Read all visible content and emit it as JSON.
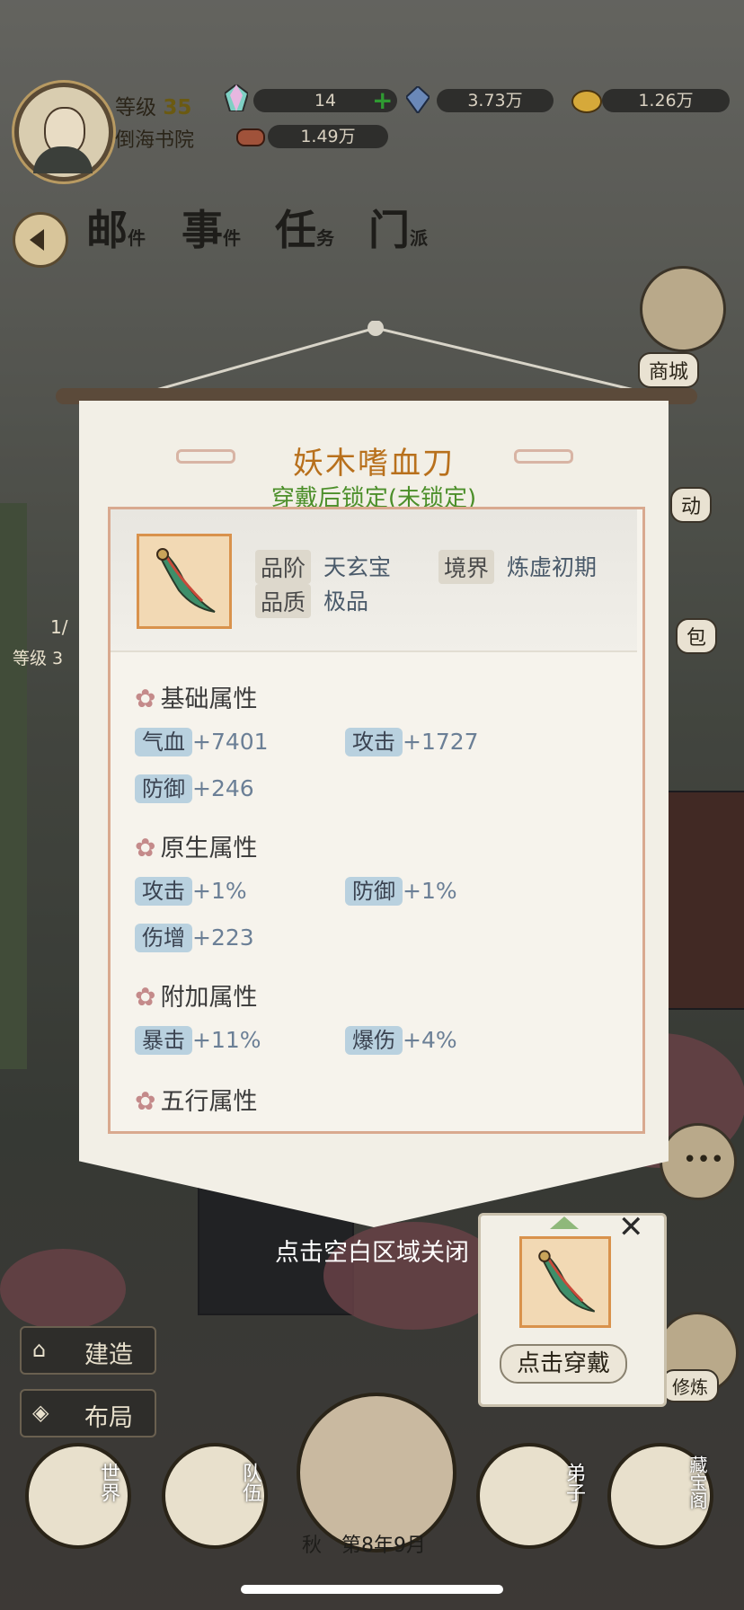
{
  "topbar": {
    "level_label": "等级",
    "level_value": "35",
    "sect_name": "倒海书院",
    "resources": [
      {
        "icon": "rainbow-crystal-icon",
        "value": "14"
      },
      {
        "icon": "blue-stone-icon",
        "value": "3.73万"
      },
      {
        "icon": "gold-ore-icon",
        "value": "1.26万"
      },
      {
        "icon": "wood-log-icon",
        "value": "1.49万"
      }
    ]
  },
  "nav": {
    "items": [
      {
        "main": "邮",
        "sub": "件"
      },
      {
        "main": "事",
        "sub": "件"
      },
      {
        "main": "任",
        "sub": "务"
      },
      {
        "main": "门",
        "sub": "派"
      }
    ]
  },
  "side": {
    "shop": "商城",
    "activity": "动",
    "bag": "包",
    "cultivate": "修炼"
  },
  "left_partial": {
    "count": "1/",
    "level": "等级 3"
  },
  "panel": {
    "item_name": "妖木嗜血刀",
    "lock_status": "穿戴后锁定(未锁定)",
    "grade_label": "品阶",
    "grade_value": "天玄宝",
    "realm_label": "境界",
    "realm_value": "炼虚初期",
    "quality_label": "品质",
    "quality_value": "极品",
    "sections": [
      {
        "title": "基础属性",
        "stats": [
          {
            "name": "气血",
            "value": "+7401"
          },
          {
            "name": "攻击",
            "value": "+1727"
          },
          {
            "name": "防御",
            "value": "+246"
          }
        ]
      },
      {
        "title": "原生属性",
        "stats": [
          {
            "name": "攻击",
            "value": "+1%"
          },
          {
            "name": "防御",
            "value": "+1%"
          },
          {
            "name": "伤增",
            "value": "+223"
          }
        ]
      },
      {
        "title": "附加属性",
        "stats": [
          {
            "name": "暴击",
            "value": "+11%"
          },
          {
            "name": "爆伤",
            "value": "+4%"
          }
        ]
      },
      {
        "title": "五行属性",
        "stats": []
      }
    ]
  },
  "close_hint": "点击空白区域关闭",
  "wear_card": {
    "button": "点击穿戴"
  },
  "left_buttons": {
    "build": "建造",
    "layout": "布局"
  },
  "bottom_nav": {
    "world": "世界",
    "team": "队伍",
    "disciples": "弟子",
    "treasure": "藏宝阁",
    "season": "秋",
    "date": "第8年9月"
  },
  "colors": {
    "title_orange": "#b8701c",
    "lock_green": "#4c8f2a",
    "chip_blue": "#b9d1df",
    "panel_bg": "#f2efe6"
  }
}
